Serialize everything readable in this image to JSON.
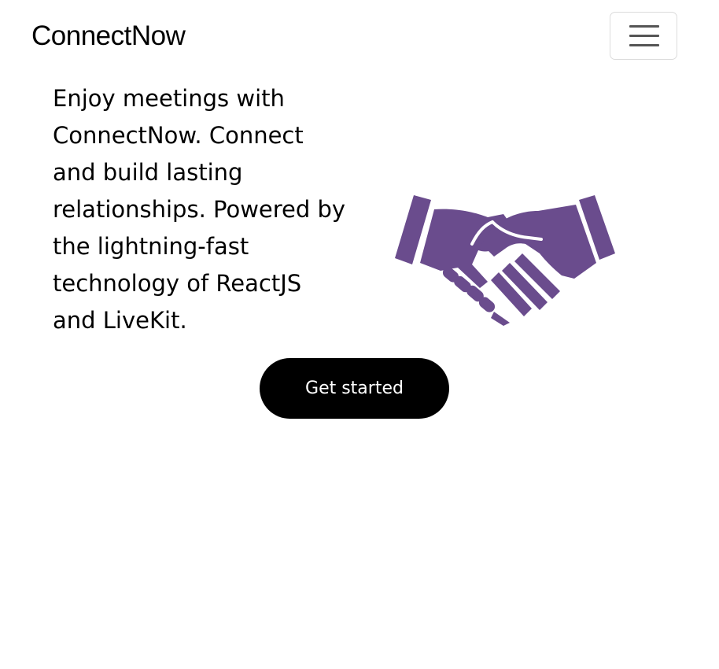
{
  "navbar": {
    "brand": "ConnectNow",
    "toggler_icon": "hamburger-menu-icon"
  },
  "hero": {
    "text": "Enjoy meetings with ConnectNow. Connect and build lasting relationships. Powered by the lightning-fast technology of ReactJS and LiveKit.",
    "illustration_icon": "handshake-icon",
    "illustration_color": "#6a4c8d",
    "cta_label": "Get started"
  }
}
